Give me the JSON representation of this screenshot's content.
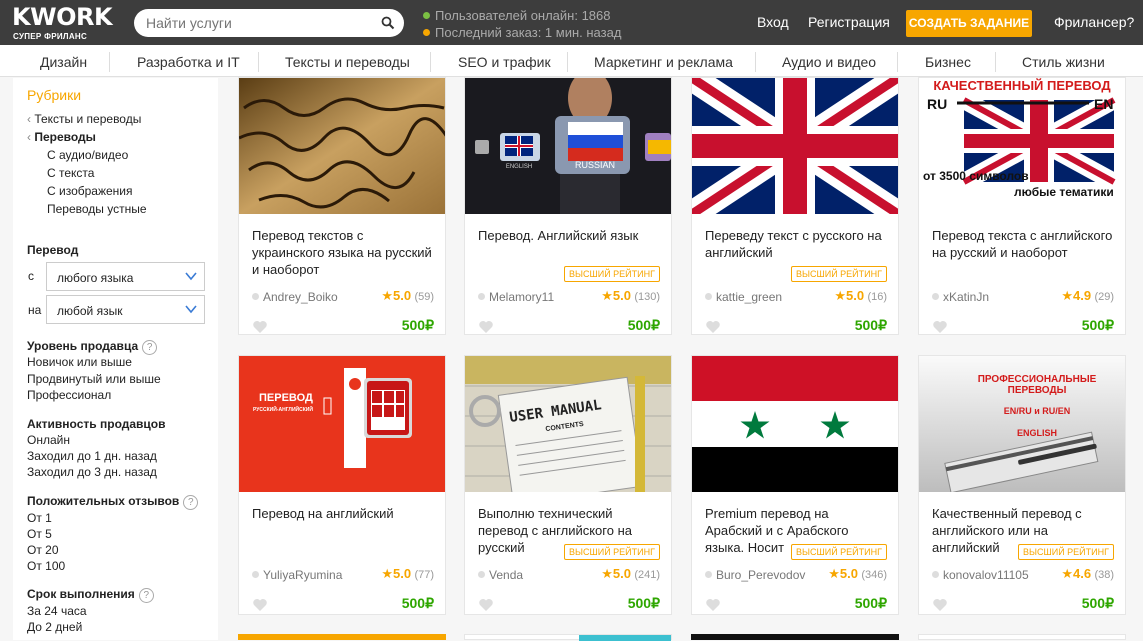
{
  "header": {
    "logo": "KWORK",
    "logo_sub": "СУПЕР ФРИЛАНС",
    "search_placeholder": "Найти услуги",
    "online": "Пользователей онлайн: 1868",
    "last_order": "Последний заказ: 1 мин. назад",
    "login": "Вход",
    "register": "Регистрация",
    "create_task": "СОЗДАТЬ ЗАДАНИЕ",
    "freelancer": "Фрилансер?",
    "colors": {
      "bg": "#3d3d3d",
      "accent": "#f7a600",
      "online_dot": "#7bc043",
      "order_dot": "#f7a600"
    }
  },
  "nav": [
    "Дизайн",
    "Разработка и IT",
    "Тексты и переводы",
    "SEO и трафик",
    "Маркетинг и реклама",
    "Аудио и видео",
    "Бизнес",
    "Стиль жизни"
  ],
  "sidebar": {
    "title": "Рубрики",
    "crumb1": "Тексты и переводы",
    "crumb2": "Переводы",
    "subs": [
      "С аудио/видео",
      "С текста",
      "С изображения",
      "Переводы устные"
    ],
    "translation": {
      "title": "Перевод",
      "from_label": "с",
      "from_value": "любого языка",
      "to_label": "на",
      "to_value": "любой язык"
    },
    "level": {
      "title": "Уровень продавца",
      "items": [
        "Новичок или выше",
        "Продвинутый или выше",
        "Профессионал"
      ]
    },
    "activity": {
      "title": "Активность продавцов",
      "items": [
        "Онлайн",
        "Заходил до 1 дн. назад",
        "Заходил до 3 дн. назад"
      ]
    },
    "reviews": {
      "title": "Положительных отзывов",
      "items": [
        "От 1",
        "От 5",
        "От 20",
        "От 100"
      ]
    },
    "deadline": {
      "title": "Срок выполнения",
      "items": [
        "За 24 часа",
        "До 2 дней"
      ]
    }
  },
  "cards": [
    {
      "title": "Перевод текстов с украинского языка на русский и наоборот",
      "seller": "Andrey_Boiko",
      "rating": "5.0",
      "count": "(59)",
      "price": "500₽",
      "badge": ""
    },
    {
      "title": "Перевод. Английский язык",
      "seller": "Melamory11",
      "rating": "5.0",
      "count": "(130)",
      "price": "500₽",
      "badge": "ВЫСШИЙ РЕЙТИНГ",
      "img_text": "RUSSIAN",
      "img_text2": "ENGLISH"
    },
    {
      "title": "Переведу текст с русского на английский",
      "seller": "kattie_green",
      "rating": "5.0",
      "count": "(16)",
      "price": "500₽",
      "badge": "ВЫСШИЙ РЕЙТИНГ"
    },
    {
      "title": "Перевод текста с английского на русский и наоборот",
      "seller": "xKatinJn",
      "rating": "4.9",
      "count": "(29)",
      "price": "500₽",
      "badge": "",
      "img_top": "КАЧЕСТВЕННЫЙ ПЕРЕВОД",
      "img_ru": "RU",
      "img_en": "EN",
      "img_b1": "от 3500 символов",
      "img_b2": "любые тематики"
    },
    {
      "title": "Перевод на английский",
      "seller": "YuliyaRyumina",
      "rating": "5.0",
      "count": "(77)",
      "price": "500₽",
      "badge": "",
      "img_t1": "ПЕРЕВОД",
      "img_t2": "РУССКИЙ-АНГЛИЙСКИЙ"
    },
    {
      "title": "Выполню технический перевод с английского на русский",
      "seller": "Venda",
      "rating": "5.0",
      "count": "(241)",
      "price": "500₽",
      "badge": "ВЫСШИЙ РЕЙТИНГ",
      "img_t1": "USER MANUAL",
      "img_t2": "CONTENTS"
    },
    {
      "title": "Premium перевод на Арабский и с Арабского языка. Носит",
      "seller": "Buro_Perevodov",
      "rating": "5.0",
      "count": "(346)",
      "price": "500₽",
      "badge": "ВЫСШИЙ РЕЙТИНГ"
    },
    {
      "title": "Качественный перевод с английского или на английский",
      "seller": "konovalov11105",
      "rating": "4.6",
      "count": "(38)",
      "price": "500₽",
      "badge": "ВЫСШИЙ РЕЙТИНГ",
      "img_t1": "ПРОФЕССИОНАЛЬНЫЕ",
      "img_t2": "ПЕРЕВОДЫ",
      "img_t3": "EN/RU и RU/EN",
      "img_t4": "ENGLISH"
    }
  ]
}
